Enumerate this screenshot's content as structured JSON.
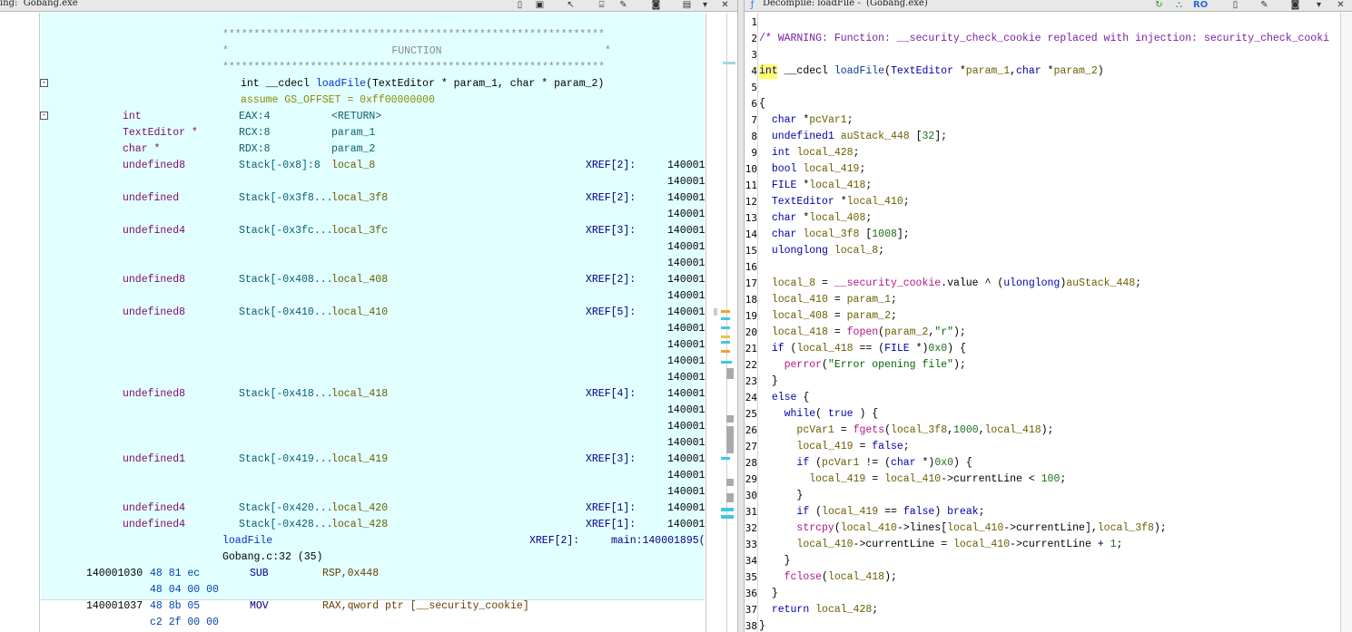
{
  "listing": {
    "title": "ing:  Gobang.exe",
    "header_stars": "*************************************************************",
    "header_function": "*                          FUNCTION                          *",
    "signature": "int __cdecl loadFile(TextEditor * param_1, char * param_2)",
    "signature_parts": {
      "ret": "int",
      "cc": " __cdecl ",
      "name": "loadFile",
      "args": "(TextEditor * param_1, char * param_2)"
    },
    "assume": "assume GS_OFFSET = 0xff00000000",
    "params": [
      {
        "type": "int",
        "storage": "EAX:4",
        "name": "<RETURN>"
      },
      {
        "type": "TextEditor *",
        "storage": "RCX:8",
        "name": "param_1"
      },
      {
        "type": "char *",
        "storage": "RDX:8",
        "name": "param_2"
      }
    ],
    "locals": [
      {
        "type": "undefined8",
        "storage": "Stack[-0x8]:8",
        "name": "local_8",
        "xref": "XREF[2]:",
        "refs": [
          "140001",
          "140001"
        ]
      },
      {
        "type": "undefined",
        "storage": "Stack[-0x3f8...",
        "name": "local_3f8",
        "xref": "XREF[2]:",
        "refs": [
          "140001",
          "140001"
        ]
      },
      {
        "type": "undefined4",
        "storage": "Stack[-0x3fc...",
        "name": "local_3fc",
        "xref": "XREF[3]:",
        "refs": [
          "140001",
          "140001",
          "140001"
        ]
      },
      {
        "type": "undefined8",
        "storage": "Stack[-0x408...",
        "name": "local_408",
        "xref": "XREF[2]:",
        "refs": [
          "140001",
          "140001"
        ]
      },
      {
        "type": "undefined8",
        "storage": "Stack[-0x410...",
        "name": "local_410",
        "xref": "XREF[5]:",
        "refs": [
          "140001",
          "140001",
          "140001",
          "140001",
          "140001"
        ]
      },
      {
        "type": "undefined8",
        "storage": "Stack[-0x418...",
        "name": "local_418",
        "xref": "XREF[4]:",
        "refs": [
          "140001",
          "140001",
          "140001",
          "140001"
        ]
      },
      {
        "type": "undefined1",
        "storage": "Stack[-0x419...",
        "name": "local_419",
        "xref": "XREF[3]:",
        "refs": [
          "140001",
          "140001",
          "140001"
        ]
      },
      {
        "type": "undefined4",
        "storage": "Stack[-0x420...",
        "name": "local_420",
        "xref": "XREF[1]:",
        "refs": [
          "140001"
        ]
      },
      {
        "type": "undefined4",
        "storage": "Stack[-0x428...",
        "name": "local_428",
        "xref": "XREF[1]:",
        "refs": [
          "140001"
        ]
      }
    ],
    "label": "loadFile",
    "label_xref": "XREF[2]:",
    "label_ref": "main:140001895(",
    "source_line": "Gobang.c:32 (35)",
    "instructions": [
      {
        "addr": "140001030",
        "bytes1": "48 81 ec",
        "bytes2": "48 04 00 00",
        "mnemonic": "SUB",
        "operands": "RSP,0x448"
      },
      {
        "addr": "140001037",
        "bytes1": "48 8b 05",
        "bytes2": "c2 2f 00 00",
        "mnemonic": "MOV",
        "operands": "RAX,qword ptr [__security_cookie]"
      }
    ]
  },
  "decompile": {
    "title": "Decompile: loadFile -  (Gobang.exe)",
    "lines": [
      "",
      "/* WARNING: Function: __security_check_cookie replaced with injection: security_check_cooki",
      "",
      "int __cdecl loadFile(TextEditor *param_1,char *param_2)",
      "",
      "{",
      "  char *pcVar1;",
      "  undefined1 auStack_448 [32];",
      "  int local_428;",
      "  bool local_419;",
      "  FILE *local_418;",
      "  TextEditor *local_410;",
      "  char *local_408;",
      "  char local_3f8 [1008];",
      "  ulonglong local_8;",
      "",
      "  local_8 = __security_cookie.value ^ (ulonglong)auStack_448;",
      "  local_410 = param_1;",
      "  local_408 = param_2;",
      "  local_418 = fopen(param_2,\"r\");",
      "  if (local_418 == (FILE *)0x0) {",
      "    perror(\"Error opening file\");",
      "  }",
      "  else {",
      "    while( true ) {",
      "      pcVar1 = fgets(local_3f8,1000,local_418);",
      "      local_419 = false;",
      "      if (pcVar1 != (char *)0x0) {",
      "        local_419 = local_410->currentLine < 100;",
      "      }",
      "      if (local_419 == false) break;",
      "      strcpy(local_410->lines[local_410->currentLine],local_3f8);",
      "      local_410->currentLine = local_410->currentLine + 1;",
      "    }",
      "    fclose(local_418);",
      "  }",
      "  return local_428;",
      "}"
    ]
  },
  "colors": {
    "listing_bg": "#e2ffff",
    "cursor": "#ffff66"
  }
}
